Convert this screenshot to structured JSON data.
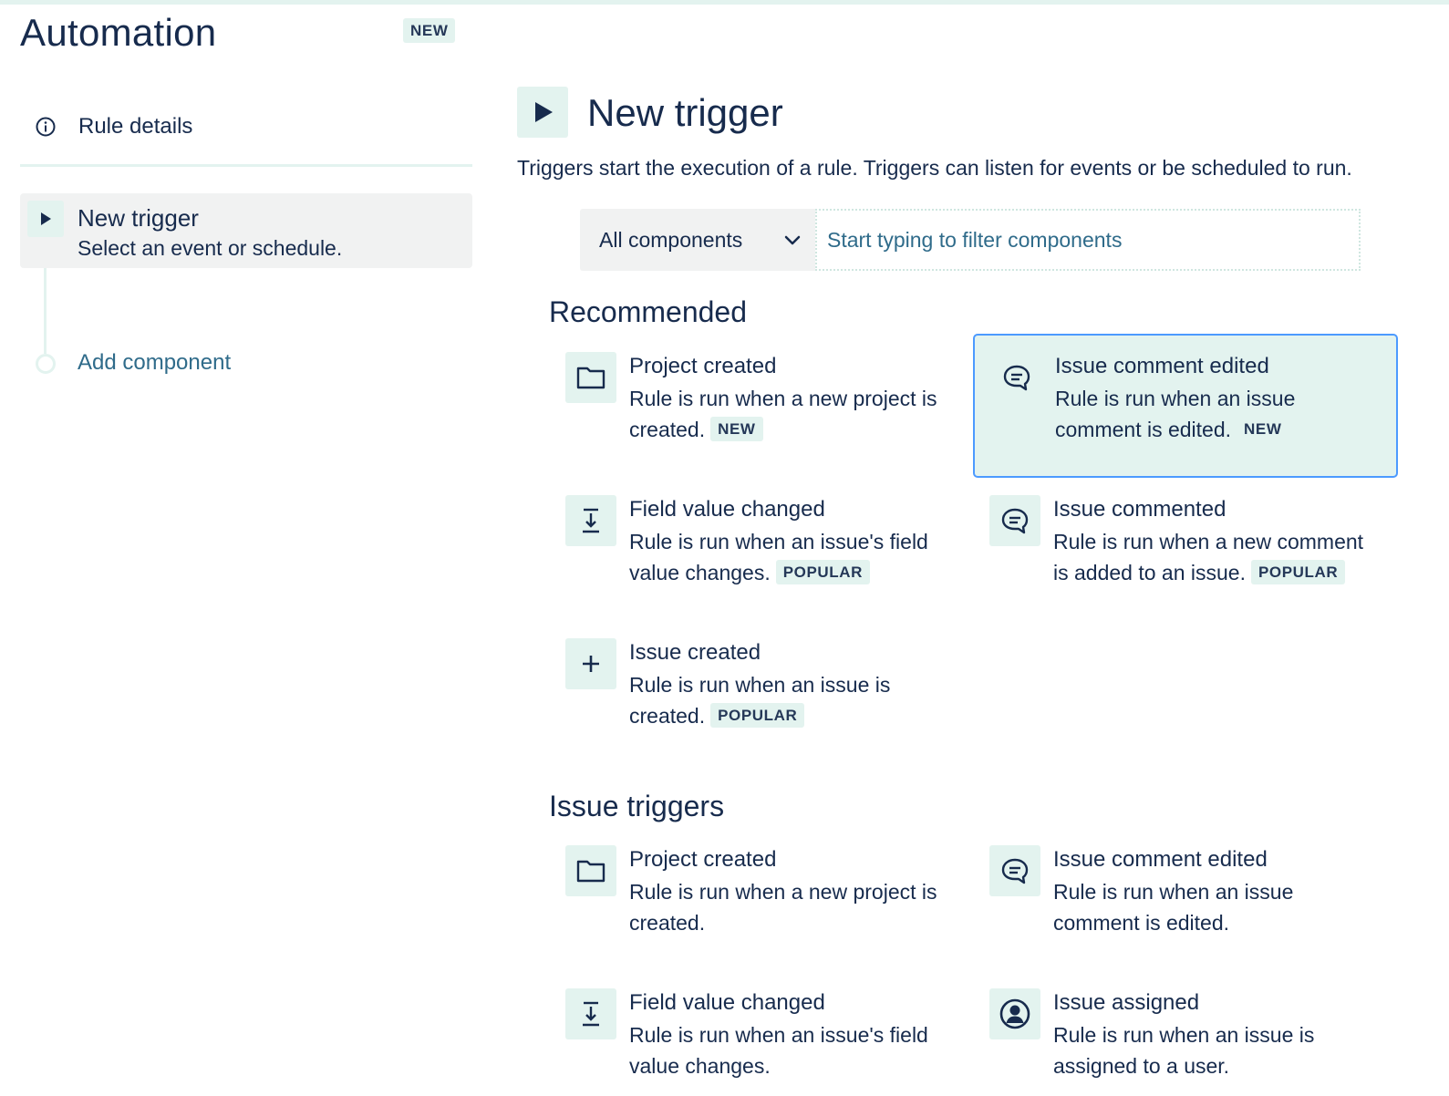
{
  "app": {
    "title": "Automation",
    "badge": "NEW"
  },
  "sidebar": {
    "rule_details": "Rule details",
    "trigger": {
      "title": "New trigger",
      "subtitle": "Select an event or schedule."
    },
    "add_component": "Add component"
  },
  "main": {
    "title": "New trigger",
    "description": "Triggers start the execution of a rule. Triggers can listen for events or be scheduled to run.",
    "filter": {
      "select_value": "All components",
      "placeholder": "Start typing to filter components"
    }
  },
  "sections": {
    "recommended": {
      "title": "Recommended",
      "items": [
        {
          "title": "Project created",
          "desc": "Rule is run when a new project is created.",
          "badge": "NEW",
          "icon": "folder-icon"
        },
        {
          "title": "Issue comment edited",
          "desc": "Rule is run when an issue comment is edited.",
          "badge": "NEW",
          "icon": "comment-icon"
        },
        {
          "title": "Field value changed",
          "desc": "Rule is run when an issue's field value changes.",
          "badge": "POPULAR",
          "icon": "field-change-icon"
        },
        {
          "title": "Issue commented",
          "desc": "Rule is run when a new comment is added to an issue.",
          "badge": "POPULAR",
          "icon": "comment-icon"
        },
        {
          "title": "Issue created",
          "desc": "Rule is run when an issue is created.",
          "badge": "POPULAR",
          "icon": "plus-icon"
        }
      ]
    },
    "issue_triggers": {
      "title": "Issue triggers",
      "items": [
        {
          "title": "Project created",
          "desc": "Rule is run when a new project is created.",
          "icon": "folder-icon"
        },
        {
          "title": "Issue comment edited",
          "desc": "Rule is run when an issue comment is edited.",
          "icon": "comment-icon"
        },
        {
          "title": "Field value changed",
          "desc": "Rule is run when an issue's field value changes.",
          "icon": "field-change-icon"
        },
        {
          "title": "Issue assigned",
          "desc": "Rule is run when an issue is assigned to a user.",
          "icon": "user-icon"
        }
      ]
    }
  },
  "colors": {
    "accent_bg": "#e3f3ef",
    "text": "#172b4d",
    "link": "#2f6b8a",
    "selected_border": "#4c9aff"
  }
}
